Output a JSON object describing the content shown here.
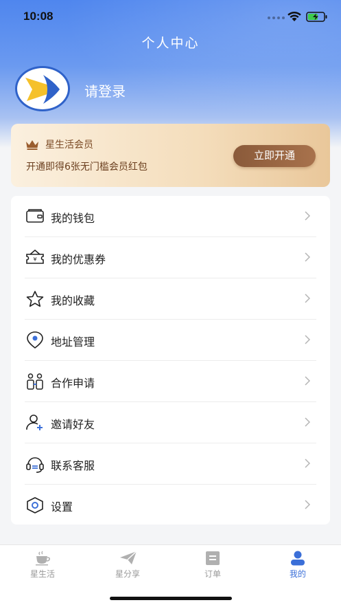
{
  "status_bar": {
    "time": "10:08"
  },
  "header": {
    "title": "个人中心",
    "login_prompt": "请登录"
  },
  "membership": {
    "title": "星生活会员",
    "description": "开通即得6张无门槛会员红包",
    "button_label": "立即开通",
    "accent_color": "#8a5a3a"
  },
  "menu": {
    "items": [
      {
        "label": "我的钱包",
        "icon": "wallet-icon"
      },
      {
        "label": "我的优惠券",
        "icon": "coupon-icon"
      },
      {
        "label": "我的收藏",
        "icon": "star-icon"
      },
      {
        "label": "地址管理",
        "icon": "location-pin-icon"
      },
      {
        "label": "合作申请",
        "icon": "partners-icon"
      },
      {
        "label": "邀请好友",
        "icon": "add-user-icon"
      },
      {
        "label": "联系客服",
        "icon": "headset-icon"
      },
      {
        "label": "设置",
        "icon": "settings-hexagon-icon"
      }
    ]
  },
  "tabbar": {
    "tabs": [
      {
        "label": "星生活",
        "icon": "coffee-cup-icon",
        "active": false
      },
      {
        "label": "星分享",
        "icon": "paper-plane-icon",
        "active": false
      },
      {
        "label": "订单",
        "icon": "order-document-icon",
        "active": false
      },
      {
        "label": "我的",
        "icon": "user-icon",
        "active": true
      }
    ],
    "active_color": "#3b6fd8",
    "inactive_color": "#9a9a9a"
  },
  "colors": {
    "primary_blue": "#4f86ee"
  }
}
